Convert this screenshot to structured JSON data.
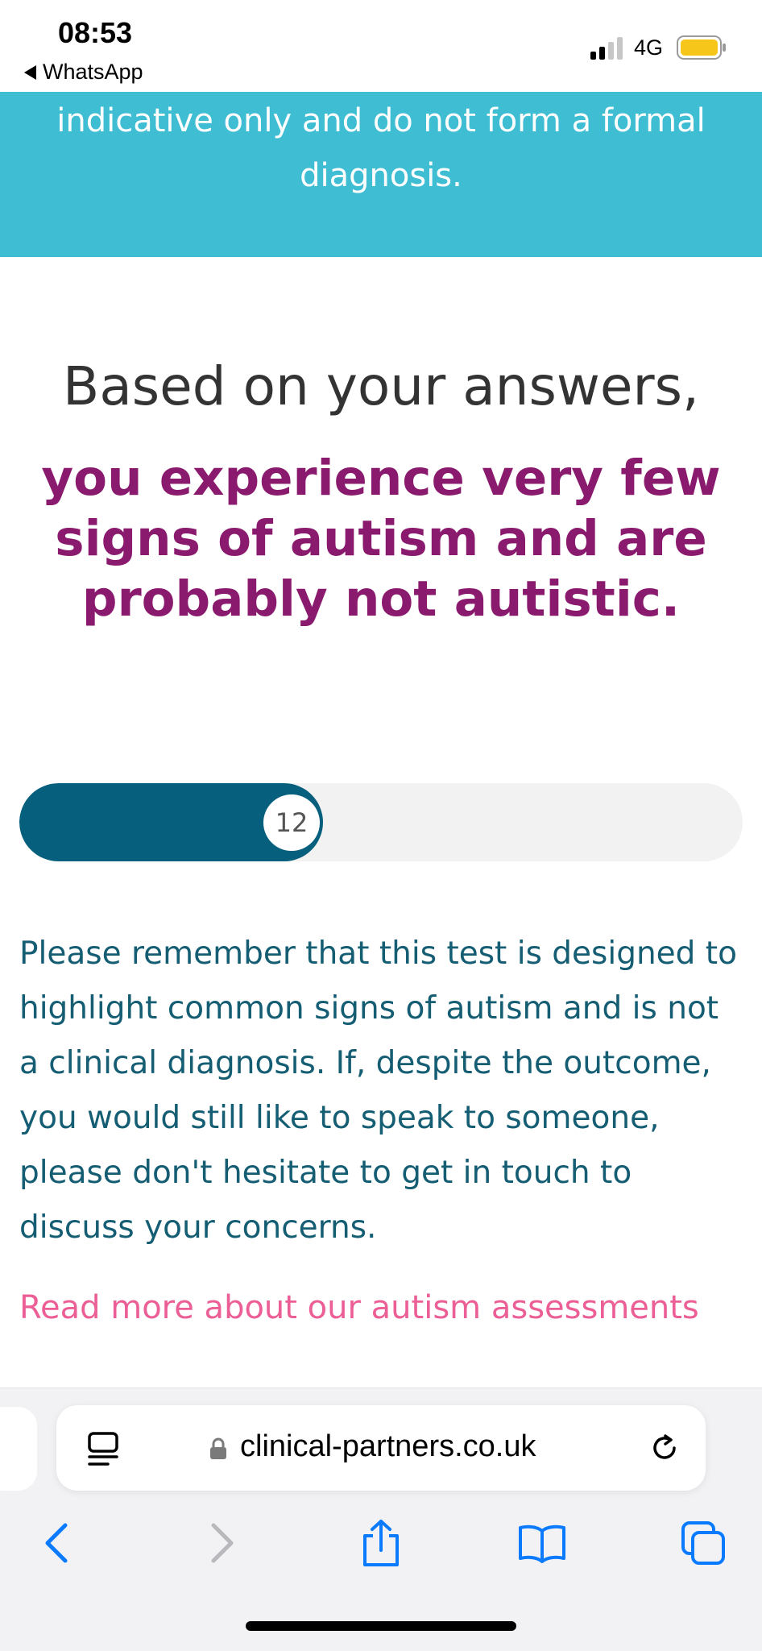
{
  "status_bar": {
    "time": "08:53",
    "back_app": "WhatsApp",
    "network": "4G",
    "battery_color": "#f7c61a"
  },
  "banner": {
    "text": "indicative only and do not form a formal diagnosis.",
    "background": "#3ebdd3"
  },
  "result": {
    "lead": "Based on your answers,",
    "outcome": "you experience very few signs of autism and are probably not autistic.",
    "outcome_color": "#8a1a6e"
  },
  "score": {
    "value": "12",
    "fill_fraction": 0.42,
    "fill_color": "#065f7d"
  },
  "body": {
    "paragraph": "Please remember that this test is designed to highlight common signs of autism and is not a clinical diagnosis. If, despite the outcome, you would still like to speak to someone, please don't hesitate to get in touch to discuss your concerns.",
    "link_text": "Read more about our autism assessments",
    "link_color": "#ec5f96"
  },
  "browser": {
    "url": "clinical-partners.co.uk",
    "toolbar": [
      "back-icon",
      "forward-icon",
      "share-icon",
      "bookmarks-icon",
      "tabs-icon"
    ],
    "accent": "#0a7aff"
  }
}
